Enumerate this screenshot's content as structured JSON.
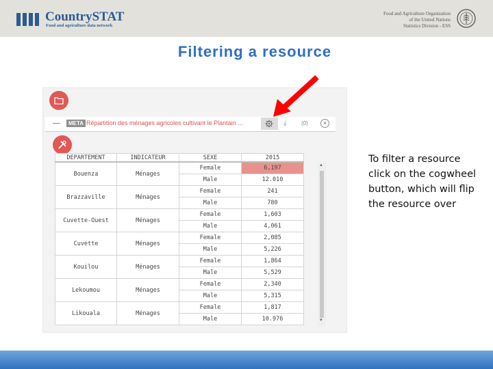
{
  "header": {
    "logo_text": "CountrySTAT",
    "logo_subtitle": "Food and agriculture data network",
    "org_lines": [
      "Food and Agriculture Organization",
      "of the United Nations",
      "Statistics Division - ESS"
    ]
  },
  "slide": {
    "title": "Filtering a resource",
    "caption": "To filter a resource click on the cogwheel button, which will flip the resource over"
  },
  "resource": {
    "meta_badge": "META",
    "title": "Répartition des ménages agricoles cultivant le Plantain ...",
    "count": "(0)",
    "close": "×"
  },
  "table": {
    "headers": [
      "DEPARTEMENT",
      "INDICATEUR",
      "SEXE",
      "2015"
    ],
    "rows": [
      {
        "departement": "Bouenza",
        "indicateur": "Ménages",
        "sexe": "Female",
        "value": "6,197"
      },
      {
        "departement": "",
        "indicateur": "",
        "sexe": "Male",
        "value": "12.010"
      },
      {
        "departement": "Brazzaville",
        "indicateur": "Ménages",
        "sexe": "Female",
        "value": "241"
      },
      {
        "departement": "",
        "indicateur": "",
        "sexe": "Male",
        "value": "780"
      },
      {
        "departement": "Cuvette-Ouest",
        "indicateur": "Ménages",
        "sexe": "Female",
        "value": "1,603"
      },
      {
        "departement": "",
        "indicateur": "",
        "sexe": "Male",
        "value": "4,061"
      },
      {
        "departement": "Cuvette",
        "indicateur": "Ménages",
        "sexe": "Female",
        "value": "2,085"
      },
      {
        "departement": "",
        "indicateur": "",
        "sexe": "Male",
        "value": "5,226"
      },
      {
        "departement": "Kouilou",
        "indicateur": "Ménages",
        "sexe": "Female",
        "value": "1,864"
      },
      {
        "departement": "",
        "indicateur": "",
        "sexe": "Male",
        "value": "5,529"
      },
      {
        "departement": "Lekoumou",
        "indicateur": "Ménages",
        "sexe": "Female",
        "value": "2,340"
      },
      {
        "departement": "",
        "indicateur": "",
        "sexe": "Male",
        "value": "5,315"
      },
      {
        "departement": "Likouala",
        "indicateur": "Ménages",
        "sexe": "Female",
        "value": "1,817"
      },
      {
        "departement": "",
        "indicateur": "",
        "sexe": "Male",
        "value": "10.976"
      }
    ]
  },
  "colors": {
    "title_blue": "#2e6fc2",
    "accent_red": "#e05a55",
    "highlight_cell": "#e8928e",
    "arrow_red": "#ff0000"
  },
  "icons": {
    "folder_button": "folder-icon",
    "tools_button": "tools-icon",
    "cog_button": "gear-icon",
    "download": "download-icon"
  }
}
